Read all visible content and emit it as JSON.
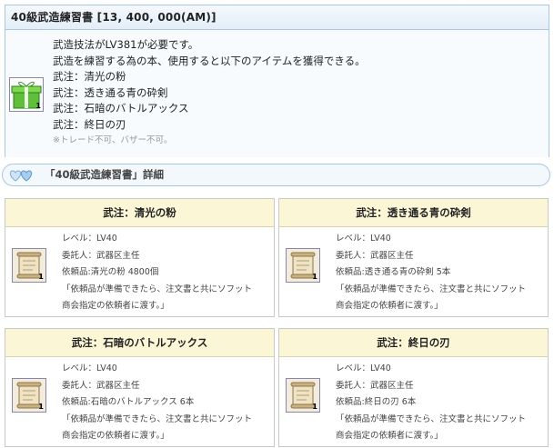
{
  "item": {
    "title": "40級武造練習書 [13, 400, 000(AM)]",
    "icon": "gift-box-icon",
    "badge": "1",
    "lines": [
      "武造技法がLV381が必要です。",
      "武造を練習する為の本、使用すると以下のアイテムを獲得できる。",
      "武注：清光の粉",
      "武注：透き通る青の砕剣",
      "武注：石暗のバトルアックス",
      "武注：終日の刃"
    ],
    "note": "※トレード不可、バザー不可。"
  },
  "section": {
    "icon": "hearts-icon",
    "label": "「40級武造練習書」詳細"
  },
  "cards": [
    {
      "title": "武注：清光の粉",
      "icon": "scroll-icon",
      "badge": "1",
      "level": "レベル：LV40",
      "client": "委託人：武器区主任",
      "request": "依頼品:清光の粉 4800個",
      "desc1": "「依頼品が準備できたら、注文書と共にソフット",
      "desc2": "商会指定の依頼者に渡す。」"
    },
    {
      "title": "武注：透き通る青の砕剣",
      "icon": "scroll-icon",
      "badge": "1",
      "level": "レベル：LV40",
      "client": "委託人：武器区主任",
      "request": "依頼品:透き通る青の砕剣 5本",
      "desc1": "「依頼品が準備できたら、注文書と共にソフット",
      "desc2": "商会指定の依頼者に渡す。」"
    },
    {
      "title": "武注：石暗のバトルアックス",
      "icon": "scroll-icon",
      "badge": "1",
      "level": "レベル：LV40",
      "client": "委託人：武器区主任",
      "request": "依頼品:石暗のバトルアックス 6本",
      "desc1": "「依頼品が準備できたら、注文書と共にソフット",
      "desc2": "商会指定の依頼者に渡す。」"
    },
    {
      "title": "武注：終日の刃",
      "icon": "scroll-icon",
      "badge": "1",
      "level": "レベル：LV40",
      "client": "委託人：武器区主任",
      "request": "依頼品:終日の刃 6本",
      "desc1": "「依頼品が準備できたら、注文書と共にソフット",
      "desc2": "商会指定の依頼者に渡す。」"
    }
  ]
}
